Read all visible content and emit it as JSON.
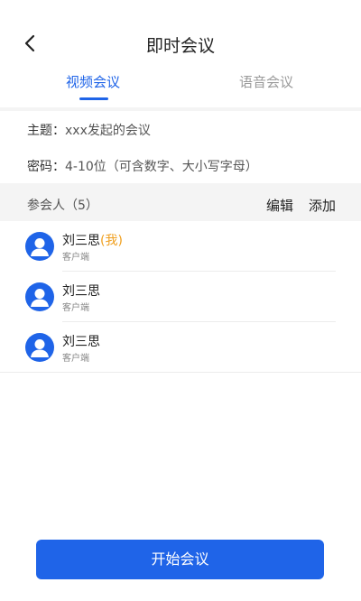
{
  "header": {
    "title": "即时会议",
    "back_icon": "chevron-left-icon"
  },
  "tabs": [
    {
      "label": "视频会议",
      "active": true
    },
    {
      "label": "语音会议",
      "active": false
    }
  ],
  "meeting": {
    "topic_label": "主题：",
    "topic_value": "xxx发起的会议",
    "password_label": "密码：",
    "password_value": "4-10位（可含数字、大小写字母）"
  },
  "participants": {
    "count_label": "参会人（5）",
    "edit_label": "编辑",
    "add_label": "添加",
    "items": [
      {
        "name": "刘三思",
        "tag": "(我)",
        "subtitle": "客户端"
      },
      {
        "name": "刘三思",
        "tag": "",
        "subtitle": "客户端"
      },
      {
        "name": "刘三思",
        "tag": "",
        "subtitle": "客户端"
      }
    ]
  },
  "footer": {
    "start_label": "开始会议"
  },
  "colors": {
    "accent": "#1f64e8",
    "me_tag": "#f0a020"
  }
}
